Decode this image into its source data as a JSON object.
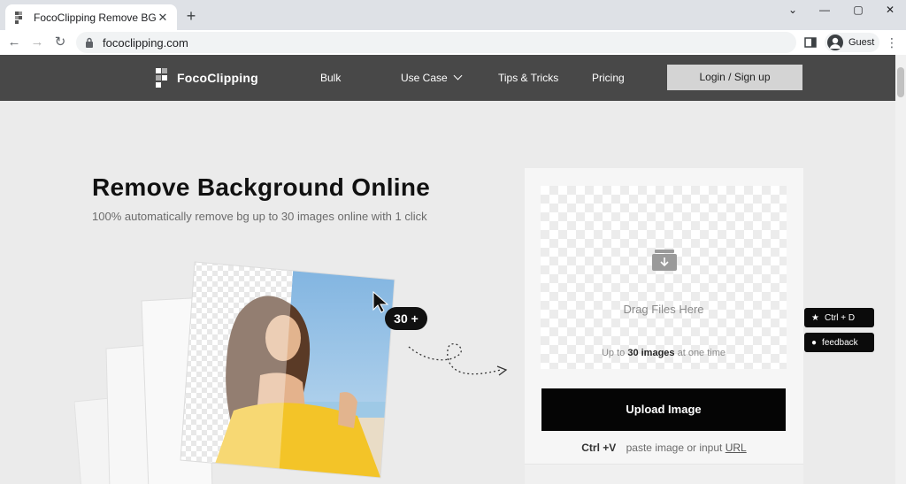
{
  "browser": {
    "tab_title": "FocoClipping Remove BG | Fre",
    "tab_close": "✕",
    "new_tab": "+",
    "url": "fococlipping.com",
    "profile_label": "Guest",
    "window_controls": {
      "collapse": "⌄",
      "minimize": "—",
      "maximize": "▢",
      "close": "✕"
    },
    "nav": {
      "back": "←",
      "forward": "→",
      "reload": "↻",
      "menu": "⋮"
    }
  },
  "header": {
    "logo_text": "FocoClipping",
    "nav": {
      "bulk": "Bulk",
      "use_case": "Use Case",
      "tips": "Tips & Tricks",
      "pricing": "Pricing"
    },
    "login_label": "Login / Sign up"
  },
  "hero": {
    "title": "Remove Background Online",
    "subtitle": "100% automatically remove bg up to 30 images online with 1 click",
    "badge": "30 +"
  },
  "upload": {
    "drag_text": "Drag Files Here",
    "limit_prefix": "Up to",
    "limit_bold": "30 images",
    "limit_suffix": "at one time",
    "button_label": "Upload Image",
    "paste_shortcut": "Ctrl +V",
    "paste_text": "paste image or input",
    "url_link": "URL"
  },
  "floating": {
    "bookmark_icon": "★",
    "bookmark_label": "Ctrl + D",
    "feedback_icon": "●",
    "feedback_label": "feedback"
  },
  "colors": {
    "header_bg": "#484848",
    "button_black": "#050505",
    "login_bg": "#d4d4d4",
    "accent_yellow": "#f3c428"
  }
}
